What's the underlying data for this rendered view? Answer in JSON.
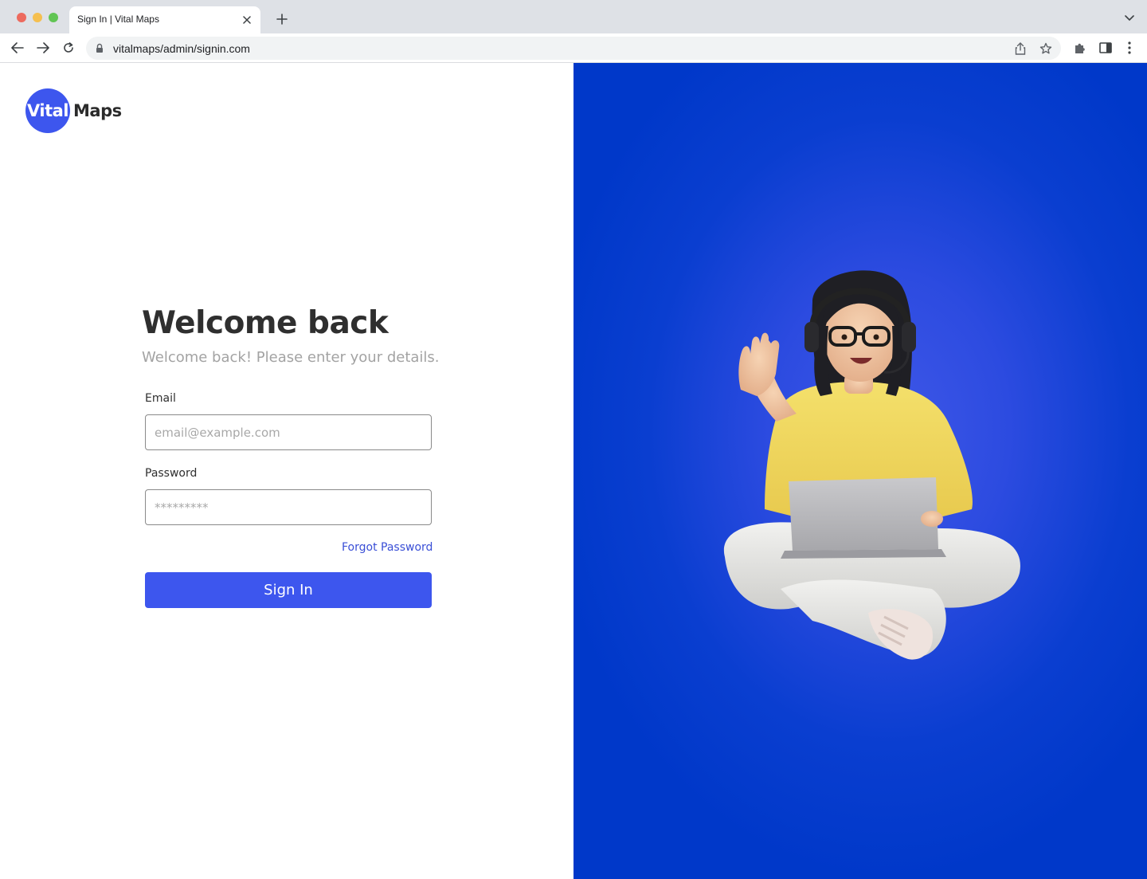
{
  "browser": {
    "tab_title": "Sign In | Vital Maps",
    "url": "vitalmaps/admin/signin.com"
  },
  "brand": {
    "logo_part1": "Vital",
    "logo_part2": "Maps",
    "accent_color": "#3d56ee",
    "panel_color": "#0038c9"
  },
  "signin": {
    "heading": "Welcome back",
    "subheading": "Welcome back! Please enter your details.",
    "email_label": "Email",
    "email_placeholder": "email@example.com",
    "password_label": "Password",
    "password_placeholder": "*********",
    "forgot_link": "Forgot Password",
    "submit_label": "Sign In"
  },
  "illustration": {
    "subject": "waving-woman-with-laptop-and-headset"
  }
}
